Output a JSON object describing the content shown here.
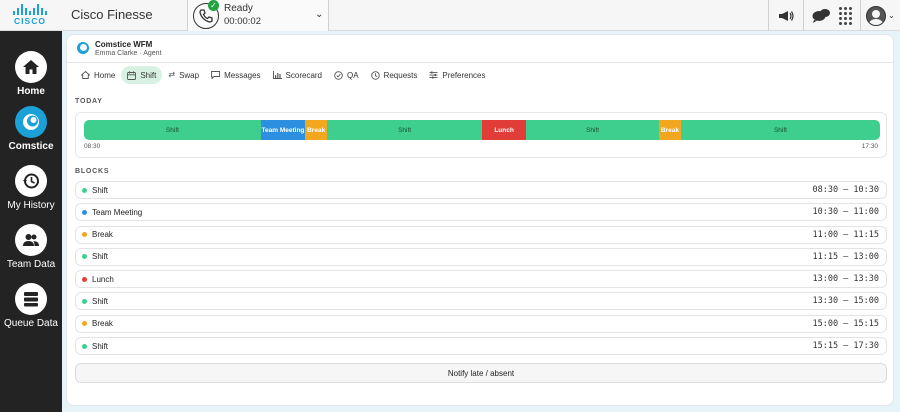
{
  "topbar": {
    "logo_text": "CISCO",
    "app_title": "Cisco Finesse",
    "status": {
      "label": "Ready",
      "timer": "00:00:02"
    }
  },
  "leftnav": {
    "items": [
      {
        "label": "Home",
        "icon": "home-icon"
      },
      {
        "label": "Comstice",
        "icon": "comstice-icon"
      },
      {
        "label": "My History",
        "icon": "history-icon"
      },
      {
        "label": "Team Data",
        "icon": "team-icon"
      },
      {
        "label": "Queue Data",
        "icon": "queue-icon"
      }
    ]
  },
  "wfm": {
    "title": "Comstice WFM",
    "user": "Emma Clarke · Agent",
    "tabs": [
      {
        "label": "Home",
        "icon": "home-icon"
      },
      {
        "label": "Shift",
        "icon": "calendar-icon"
      },
      {
        "label": "Swap",
        "icon": "swap-icon"
      },
      {
        "label": "Messages",
        "icon": "message-icon"
      },
      {
        "label": "Scorecard",
        "icon": "chart-icon"
      },
      {
        "label": "QA",
        "icon": "check-circle-icon"
      },
      {
        "label": "Requests",
        "icon": "clock-icon"
      },
      {
        "label": "Preferences",
        "icon": "sliders-icon"
      }
    ],
    "active_tab": "Shift",
    "today": {
      "title": "TODAY",
      "start": "08:30",
      "end": "17:30",
      "segments": [
        {
          "label": "Shift",
          "type": "shift",
          "start": "08:30",
          "end": "10:30"
        },
        {
          "label": "Team Meeting",
          "type": "meeting",
          "start": "10:30",
          "end": "11:00"
        },
        {
          "label": "Break",
          "type": "break",
          "start": "11:00",
          "end": "11:15"
        },
        {
          "label": "Shift",
          "type": "shift",
          "start": "11:15",
          "end": "13:00"
        },
        {
          "label": "Lunch",
          "type": "lunch",
          "start": "13:00",
          "end": "13:30"
        },
        {
          "label": "Shift",
          "type": "shift",
          "start": "13:30",
          "end": "15:00"
        },
        {
          "label": "Break",
          "type": "break",
          "start": "15:00",
          "end": "15:15"
        },
        {
          "label": "Shift",
          "type": "shift",
          "start": "15:15",
          "end": "17:30"
        }
      ]
    },
    "blocks": {
      "title": "BLOCKS",
      "items": [
        {
          "name": "Shift",
          "type": "shift",
          "time": "08:30 — 10:30"
        },
        {
          "name": "Team Meeting",
          "type": "meeting",
          "time": "10:30 — 11:00"
        },
        {
          "name": "Break",
          "type": "break",
          "time": "11:00 — 11:15"
        },
        {
          "name": "Shift",
          "type": "shift",
          "time": "11:15 — 13:00"
        },
        {
          "name": "Lunch",
          "type": "lunch",
          "time": "13:00 — 13:30"
        },
        {
          "name": "Shift",
          "type": "shift",
          "time": "13:30 — 15:00"
        },
        {
          "name": "Break",
          "type": "break",
          "time": "15:00 — 15:15"
        },
        {
          "name": "Shift",
          "type": "shift",
          "time": "15:15 — 17:30"
        }
      ]
    },
    "notify_button": "Notify late / absent"
  },
  "colors": {
    "shift": "#3ecf8e",
    "meeting": "#2c8fe0",
    "break": "#f2a71e",
    "lunch": "#e23c38",
    "accent": "#1ba0d7"
  }
}
